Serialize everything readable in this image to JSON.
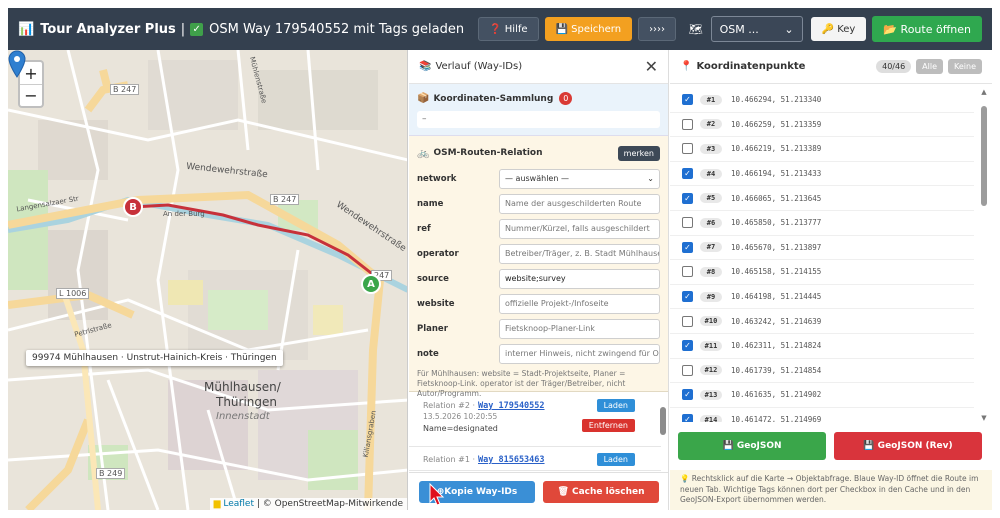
{
  "header": {
    "app_icon": "📊",
    "app_title": "Tour Analyzer Plus",
    "separator": "|",
    "check_icon": "✓",
    "status": "OSM Way 179540552 mit Tags geladen",
    "help_label": "❓ Hilfe",
    "save_label": "💾 Speichern",
    "more_label": "››››",
    "osm_icon": "🗺",
    "osm_select_value": "OSM ...",
    "key_label": "🔑 Key",
    "route_label": "📂 Route öffnen"
  },
  "map": {
    "zoom_in": "+",
    "zoom_out": "−",
    "popup": "99974 Mühlhausen · Unstrut-Hainich-Kreis · Thüringen",
    "attribution_flag": "▆",
    "attribution_leaflet": "Leaflet",
    "attribution_rest": " | © OpenStreetMap-Mitwirkende",
    "marker_b": "B",
    "marker_a": "A",
    "labels": {
      "b247_top": "B 247",
      "b247_mid": "B 247",
      "b247_right": "247",
      "l1006": "L 1006",
      "b249": "B 249",
      "wendewehr1": "Wendewehrstraße",
      "wendewehr2": "Wendewehrstraße",
      "city1": "Mühlhausen/",
      "city2": "Thüringen",
      "city3": "Innenstadt",
      "an_der_burg": "An der Burg",
      "kiliansgraben": "Kiliansgraben",
      "muehlenstr": "Mühlenstraße",
      "langensalza": "Langensalzaer Str",
      "petristr": "Petristraße"
    }
  },
  "history": {
    "icon": "📚",
    "title": "Verlauf (Way-IDs)",
    "close": "✕",
    "collection": {
      "icon": "📦",
      "label": "Koordinaten-Sammlung",
      "count": "0",
      "content": "–"
    },
    "relation": {
      "icon": "🚲",
      "label": "OSM-Routen-Relation",
      "remember_label": "merken",
      "fields": [
        {
          "label": "network",
          "value": "— auswählen —",
          "arrow": "⌄"
        },
        {
          "label": "name",
          "placeholder": "Name der ausgeschilderten Route"
        },
        {
          "label": "ref",
          "placeholder": "Nummer/Kürzel, falls ausgeschildert"
        },
        {
          "label": "operator",
          "placeholder": "Betreiber/Träger, z. B. Stadt Mühlhausen"
        },
        {
          "label": "source",
          "value": "website;survey"
        },
        {
          "label": "website",
          "placeholder": "offizielle Projekt-/Infoseite"
        },
        {
          "label": "Planer",
          "placeholder": "Fietsknoop-Planer-Link"
        },
        {
          "label": "note",
          "placeholder": "interner Hinweis, nicht zwingend für OSM"
        }
      ],
      "hint": "Für Mühlhausen: website = Stadt-Projektseite, Planer = Fietsknoop-Link. operator ist der Träger/Betreiber, nicht Autor/Programm."
    },
    "items": [
      {
        "meta": "Relation #2 ·",
        "way": "Way 179540552",
        "date": "13.5.2026 10:20:55",
        "tag": "Name=designated",
        "load": "Laden",
        "remove": "Entfernen"
      },
      {
        "meta": "Relation #1 ·",
        "way": "Way 815653463",
        "load": "Laden"
      }
    ],
    "copy_label": "Kopie Way-IDs",
    "copy_icon": "⊕",
    "clear_label": "🗑 Cache löschen"
  },
  "points": {
    "icon": "📍",
    "title": "Koordinatenpunkte",
    "count": "40/46",
    "all_label": "Alle",
    "none_label": "Keine",
    "rows": [
      {
        "idx": "#1",
        "coord": "10.466294, 51.213340",
        "checked": true
      },
      {
        "idx": "#2",
        "coord": "10.466259, 51.213359",
        "checked": false
      },
      {
        "idx": "#3",
        "coord": "10.466219, 51.213389",
        "checked": false
      },
      {
        "idx": "#4",
        "coord": "10.466194, 51.213433",
        "checked": true
      },
      {
        "idx": "#5",
        "coord": "10.466065, 51.213645",
        "checked": true
      },
      {
        "idx": "#6",
        "coord": "10.465850, 51.213777",
        "checked": false
      },
      {
        "idx": "#7",
        "coord": "10.465670, 51.213897",
        "checked": true
      },
      {
        "idx": "#8",
        "coord": "10.465158, 51.214155",
        "checked": false
      },
      {
        "idx": "#9",
        "coord": "10.464198, 51.214445",
        "checked": true
      },
      {
        "idx": "#10",
        "coord": "10.463242, 51.214639",
        "checked": false
      },
      {
        "idx": "#11",
        "coord": "10.462311, 51.214824",
        "checked": true
      },
      {
        "idx": "#12",
        "coord": "10.461739, 51.214854",
        "checked": false
      },
      {
        "idx": "#13",
        "coord": "10.461635, 51.214902",
        "checked": true
      },
      {
        "idx": "#14",
        "coord": "10.461472, 51.214969",
        "checked": true
      }
    ],
    "check_mark": "✓",
    "geojson_label": "💾 GeoJSON",
    "geojson_rev_label": "💾 GeoJSON (Rev)",
    "note": "💡 Rechtsklick auf die Karte → Objektabfrage. Blaue Way-ID öffnet die Route im neuen Tab. Wichtige Tags können dort per Checkbox in den Cache und in den GeoJSON-Export übernommen werden."
  },
  "colors": {
    "header_bg": "#34404f",
    "save": "#f3a020",
    "route_green": "#2fa84f",
    "route_line": "#c7313a",
    "checkbox_blue": "#1f6fd1"
  }
}
